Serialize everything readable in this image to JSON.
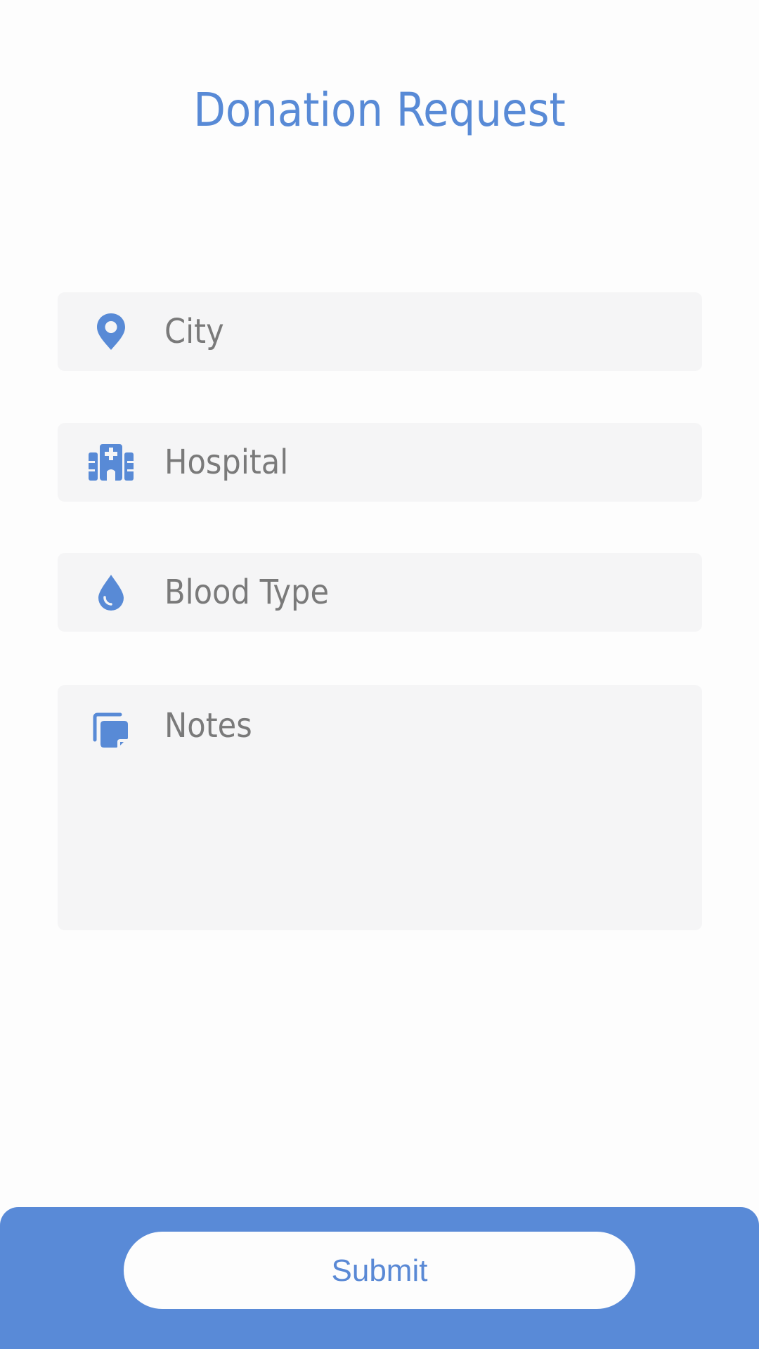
{
  "header": {
    "title": "Donation Request"
  },
  "form": {
    "fields": [
      {
        "icon": "location-pin-icon",
        "placeholder": "City"
      },
      {
        "icon": "hospital-icon",
        "placeholder": "Hospital"
      },
      {
        "icon": "blood-drop-icon",
        "placeholder": "Blood Type"
      },
      {
        "icon": "notes-icon",
        "placeholder": "Notes"
      }
    ]
  },
  "footer": {
    "submit_label": "Submit"
  },
  "colors": {
    "accent": "#588AD6",
    "field_background": "#F5F5F6",
    "placeholder_text": "#7A7A7A",
    "page_background": "#FDFDFD"
  }
}
